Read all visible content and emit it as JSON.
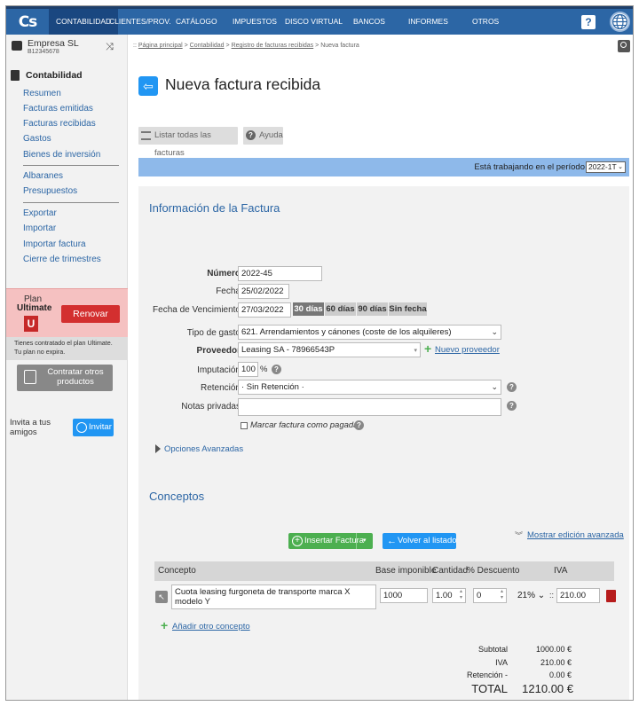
{
  "topbar": {
    "logo": "Cs",
    "nav": [
      "CONTABILIDAD",
      "CLIENTES/PROV.",
      "CATÁLOGO",
      "IMPUESTOS",
      "DISCO VIRTUAL",
      "BANCOS",
      "INFORMES",
      "OTROS"
    ],
    "active": "CONTABILIDAD",
    "help": "?"
  },
  "sidebar": {
    "company_name": "Empresa SL",
    "company_nif": "B12345678",
    "section_title": "Contabilidad",
    "group1": [
      "Resumen",
      "Facturas emitidas",
      "Facturas recibidas",
      "Gastos",
      "Bienes de inversión"
    ],
    "group2": [
      "Albaranes",
      "Presupuestos"
    ],
    "group3": [
      "Exportar",
      "Importar",
      "Importar factura",
      "Cierre de trimestres"
    ],
    "plan_label": "Plan",
    "plan_name": "Ultimate",
    "plan_badge": "U",
    "renew_label": "Renovar",
    "plan_info": "Tienes contratado el plan Ultimate. Tu plan no expira.",
    "contract_label": "Contratar otros productos",
    "invite_text": "Invita a tus amigos",
    "invite_label": "Invitar"
  },
  "breadcrumb": {
    "prefix": "::",
    "items": [
      "Página principal",
      "Contabilidad",
      "Registro de facturas recibidas"
    ],
    "current": "Nueva factura",
    "sep": ">"
  },
  "page": {
    "title": "Nueva factura recibida",
    "list_all": "Listar todas las facturas",
    "help": "Ayuda",
    "period_text": "Está trabajando en el período",
    "period_value": "2022-1T"
  },
  "form": {
    "section_title": "Información de la Factura",
    "numero_label": "Número",
    "numero_value": "2022-45",
    "fecha_label": "Fecha",
    "fecha_value": "25/02/2022",
    "vencimiento_label": "Fecha de Vencimiento",
    "vencimiento_value": "27/03/2022",
    "due_chips": [
      "30 días",
      "60 días",
      "90 días",
      "Sin fecha"
    ],
    "due_active": "30 días",
    "tipo_label": "Tipo de gasto",
    "tipo_value": "621. Arrendamientos y cánones (coste de los alquileres)",
    "proveedor_label": "Proveedor",
    "proveedor_value": "Leasing SA - 78966543P",
    "nuevo_proveedor": "Nuevo proveedor",
    "imputacion_label": "Imputación",
    "imputacion_value": "100",
    "imputacion_unit": "%",
    "retencion_label": "Retención",
    "retencion_value": "· Sin Retención ·",
    "notas_label": "Notas privadas",
    "notas_value": "",
    "pagada_label": "Marcar factura como pagada",
    "advanced": "Opciones Avanzadas"
  },
  "conceptos": {
    "section_title": "Conceptos",
    "advanced_edit": "Mostrar edición avanzada",
    "columns": [
      "Concepto",
      "Base imponible",
      "Cantidad",
      "% Descuento",
      "IVA"
    ],
    "row": {
      "concepto": "Cuota leasing furgoneta de transporte marca X modelo Y",
      "base": "1000",
      "cantidad": "1.00",
      "descuento": "0",
      "iva_pct": "21%",
      "iva_amount": "210.00"
    },
    "add_label": "Añadir otro concepto"
  },
  "totals": {
    "subtotal_label": "Subtotal",
    "subtotal_value": "1000.00 €",
    "iva_label": "IVA",
    "iva_value": "210.00 €",
    "retencion_label": "Retención -",
    "retencion_value": "0.00 €",
    "total_label": "TOTAL",
    "total_value": "1210.00 €"
  },
  "actions": {
    "insert": "Insertar Factura",
    "back": "Volver al listado"
  }
}
